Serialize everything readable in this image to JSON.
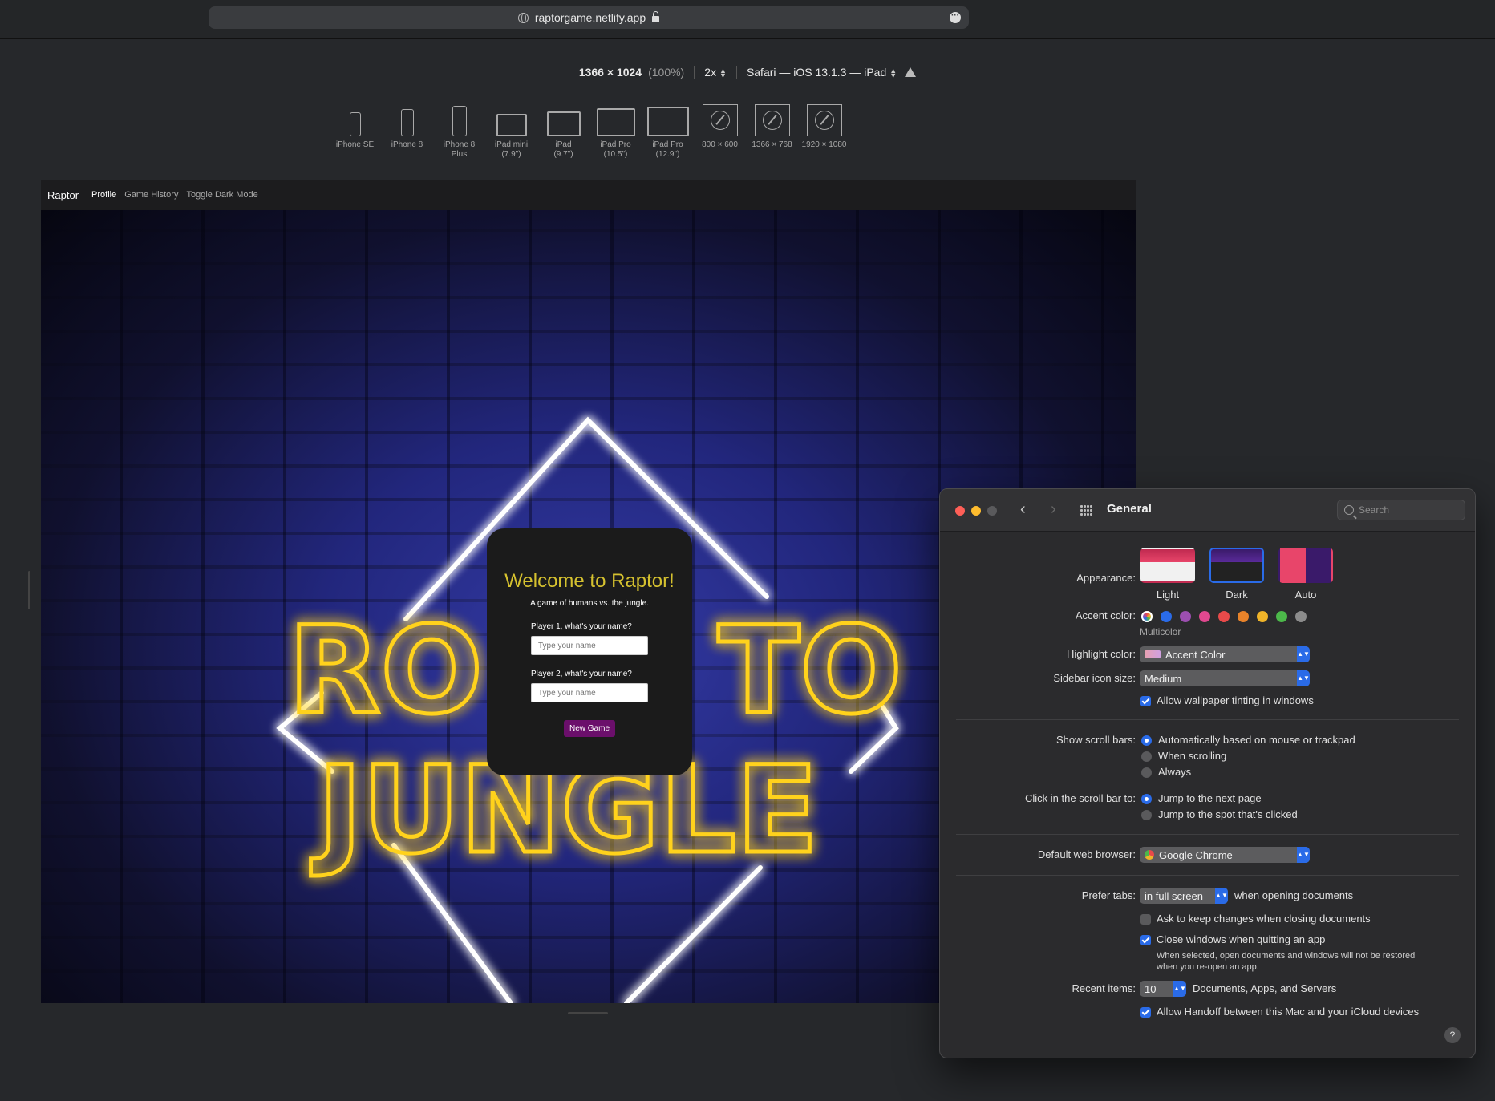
{
  "browser": {
    "url": "raptorgame.netlify.app",
    "more_icon": "ellipsis-circle-icon"
  },
  "rdm": {
    "size": "1366 × 1024",
    "zoom": "(100%)",
    "scale": "2x",
    "agent": "Safari — iOS 13.1.3 — iPad",
    "devices": [
      {
        "l1": "iPhone SE",
        "l2": ""
      },
      {
        "l1": "iPhone 8",
        "l2": ""
      },
      {
        "l1": "iPhone 8",
        "l2": "Plus"
      },
      {
        "l1": "iPad mini",
        "l2": "(7.9\")"
      },
      {
        "l1": "iPad",
        "l2": "(9.7\")"
      },
      {
        "l1": "iPad Pro",
        "l2": "(10.5\")"
      },
      {
        "l1": "iPad Pro",
        "l2": "(12.9\")"
      },
      {
        "l1": "800 × 600",
        "l2": ""
      },
      {
        "l1": "1366 × 768",
        "l2": ""
      },
      {
        "l1": "1920 × 1080",
        "l2": ""
      }
    ]
  },
  "app": {
    "brand": "Raptor",
    "nav": [
      "Profile",
      "Game History",
      "Toggle Dark Mode"
    ],
    "neon_line1_left": "RO",
    "neon_line1_right": "TO",
    "neon_line2": "JUNGLE",
    "welcome": {
      "title": "Welcome to Raptor!",
      "subtitle": "A game of humans vs. the jungle.",
      "p1_label": "Player 1, what's your name?",
      "p2_label": "Player 2, what's your name?",
      "placeholder": "Type your name",
      "button": "New Game"
    }
  },
  "prefs": {
    "title": "General",
    "search_placeholder": "Search",
    "appearance_label": "Appearance:",
    "appearance_options": [
      "Light",
      "Dark",
      "Auto"
    ],
    "appearance_selected": "Dark",
    "accent_label": "Accent color:",
    "accent_selected_name": "Multicolor",
    "accent_colors": [
      "#9b59b6",
      "#2a6be8",
      "#9c4fb0",
      "#e0488f",
      "#e84a4a",
      "#e8832a",
      "#f0b429",
      "#4cb84a",
      "#8c8c8c"
    ],
    "highlight_label": "Highlight color:",
    "highlight_value": "Accent Color",
    "sidebar_label": "Sidebar icon size:",
    "sidebar_value": "Medium",
    "wallpaper_tint": "Allow wallpaper tinting in windows",
    "scrollbars_label": "Show scroll bars:",
    "scrollbars_options": [
      "Automatically based on mouse or trackpad",
      "When scrolling",
      "Always"
    ],
    "click_label": "Click in the scroll bar to:",
    "click_options": [
      "Jump to the next page",
      "Jump to the spot that's clicked"
    ],
    "browser_label": "Default web browser:",
    "browser_value": "Google Chrome",
    "tabs_label": "Prefer tabs:",
    "tabs_value": "in full screen",
    "tabs_suffix": "when opening documents",
    "ask_keep": "Ask to keep changes when closing documents",
    "close_windows": "Close windows when quitting an app",
    "close_note_1": "When selected, open documents and windows will not be restored",
    "close_note_2": "when you re-open an app.",
    "recent_label": "Recent items:",
    "recent_value": "10",
    "recent_suffix": "Documents, Apps, and Servers",
    "handoff": "Allow Handoff between this Mac and your iCloud devices",
    "help": "?"
  }
}
